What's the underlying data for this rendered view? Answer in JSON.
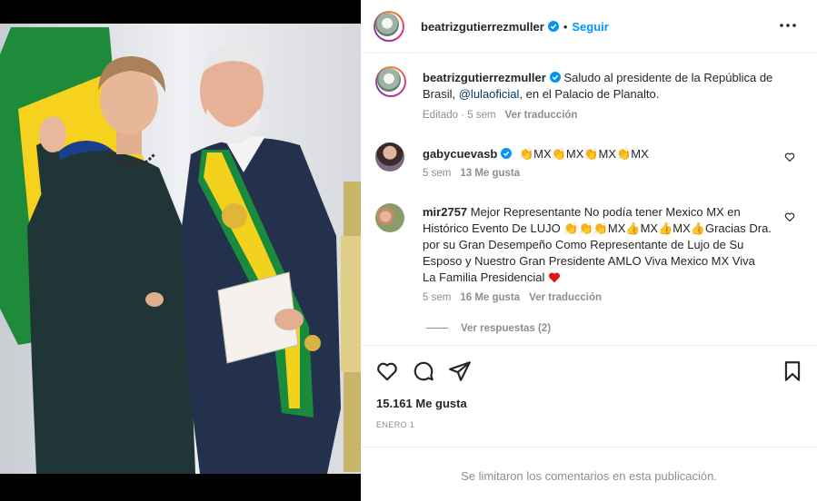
{
  "post": {
    "author": "beatrizgutierrezmuller",
    "follow_label": "Seguir",
    "separator": "•",
    "more_icon": "more-horizontal-icon",
    "caption": {
      "text_before_mention": "Saludo al presidente de la República de Brasil, ",
      "mention": "@lulaoficial",
      "text_after_mention": ", en el Palacio de Planalto.",
      "edited_label": "Editado · 5 sem",
      "translate_label": "Ver traducción"
    },
    "comments": [
      {
        "user": "gabycuevasb",
        "verified": true,
        "text": "👏MX👏MX👏MX👏MX",
        "time": "5 sem",
        "likes": "13 Me gusta"
      },
      {
        "user": "mir2757",
        "verified": false,
        "text_line1": "Mejor Representante No podía tener Mexico MX en",
        "text_line2": "Histórico Evento De LUJO 👏👏👏MX👍MX👍MX👍Gracias Dra.",
        "text_line3": "por su Gran Desempeño Como Representante de Lujo de Su",
        "text_line4": "Esposo y Nuestro Gran Presidente AMLO Viva Mexico MX Viva",
        "text_line5": "La Familia Presidencial",
        "time": "5 sem",
        "likes": "16 Me gusta",
        "translate_label": "Ver traducción",
        "view_replies": "Ver respuestas (2)"
      }
    ],
    "likes_count": "15.161 Me gusta",
    "date": "ENERO 1",
    "comments_limited": "Se limitaron los comentarios en esta publicación."
  },
  "colors": {
    "accent_blue": "#0095f6",
    "text": "#262626",
    "muted": "#8e8e8e",
    "mention": "#00376b"
  }
}
